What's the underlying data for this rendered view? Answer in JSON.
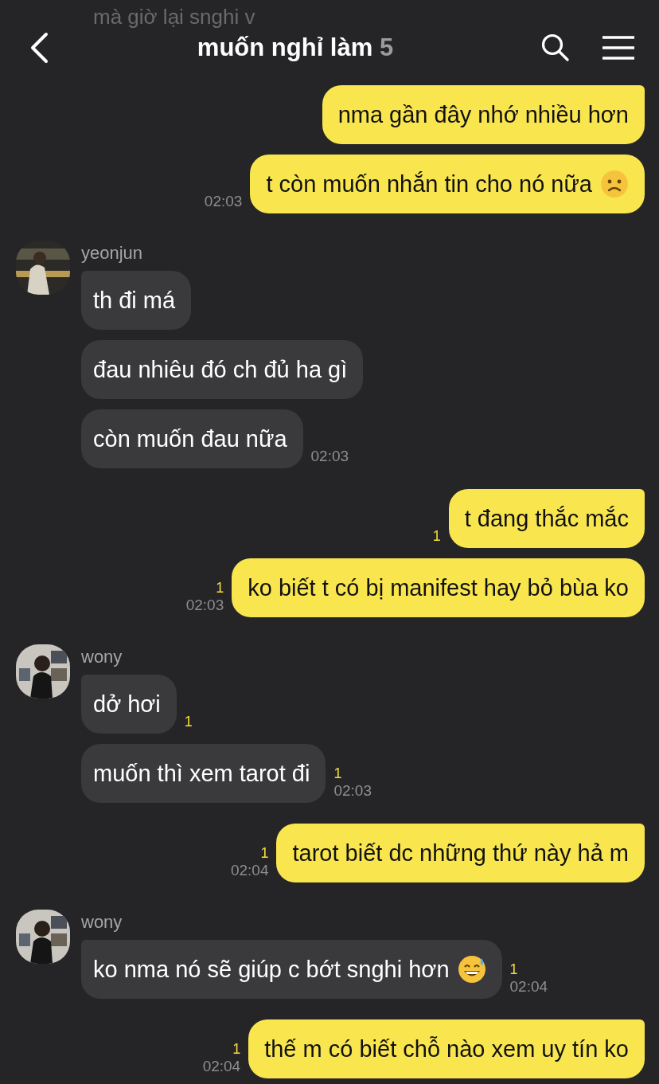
{
  "header": {
    "title": "muốn nghỉ làm",
    "member_count": "5",
    "scrolled_preview": "mà giờ lại snghi v"
  },
  "groups": [
    {
      "kind": "sent",
      "messages": [
        {
          "kind": "plain",
          "text": "nma gần đây nhớ nhiều hơn"
        },
        {
          "kind": "frown",
          "text": "t còn muốn nhắn tin cho nó nữa",
          "time": "02:03"
        }
      ]
    },
    {
      "kind": "received",
      "sender": "yeonjun",
      "avatar": {
        "kind": "picture"
      },
      "messages": [
        {
          "kind": "plain",
          "text": "th đi má"
        },
        {
          "kind": "plain",
          "text": "đau nhiêu đó ch đủ ha gì"
        },
        {
          "kind": "plain",
          "text": "còn muốn đau nữa",
          "time": "02:03"
        }
      ]
    },
    {
      "kind": "sent",
      "messages": [
        {
          "kind": "plain",
          "text": "t đang thắc mắc",
          "unread": "1"
        },
        {
          "kind": "plain",
          "text": "ko biết t có bị manifest hay bỏ bùa ko",
          "unread": "1",
          "time": "02:03"
        }
      ]
    },
    {
      "kind": "received",
      "sender": "wony",
      "avatar": {
        "kind": "picture"
      },
      "messages": [
        {
          "kind": "plain",
          "text": "dở hơi",
          "unread": "1"
        },
        {
          "kind": "plain",
          "text": "muốn thì xem tarot đi",
          "unread": "1",
          "time": "02:03"
        }
      ]
    },
    {
      "kind": "sent",
      "messages": [
        {
          "kind": "plain",
          "text": "tarot biết dc những thứ này hả m",
          "unread": "1",
          "time": "02:04"
        }
      ]
    },
    {
      "kind": "received",
      "sender": "wony",
      "avatar": {
        "kind": "picture"
      },
      "messages": [
        {
          "kind": "sweat",
          "text": "ko nma nó sẽ giúp c bớt snghi hơn",
          "unread": "1",
          "time": "02:04"
        }
      ]
    },
    {
      "kind": "sent",
      "messages": [
        {
          "kind": "plain",
          "text": "thế m có biết chỗ nào xem uy tín ko",
          "unread": "1",
          "time": "02:04"
        }
      ]
    }
  ]
}
